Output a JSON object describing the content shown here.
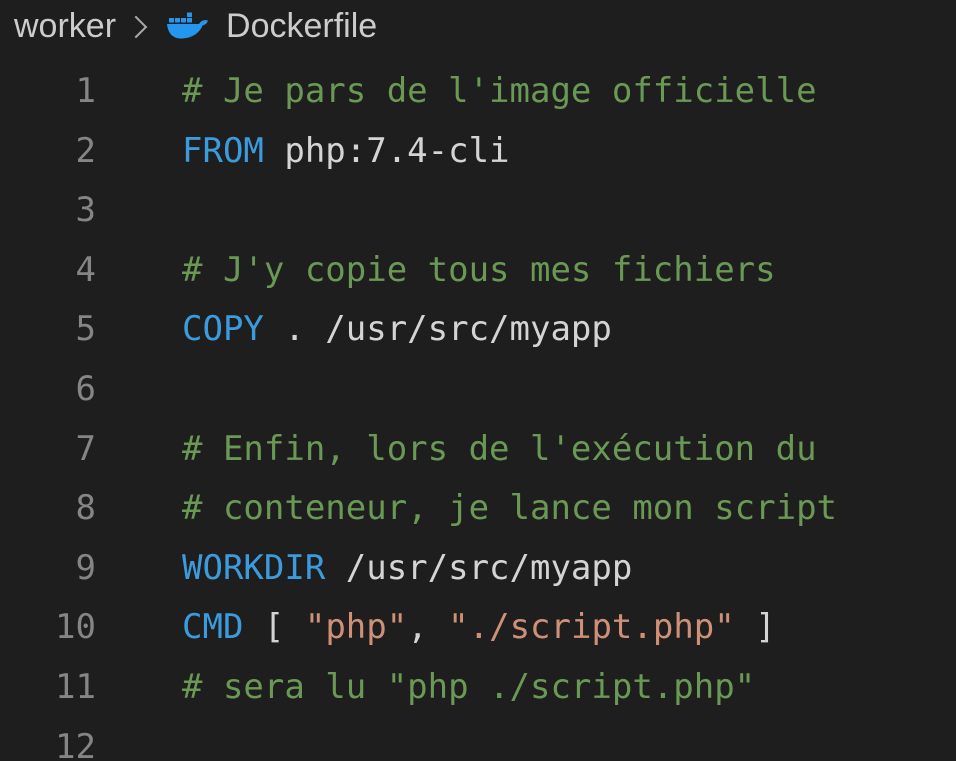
{
  "breadcrumb": {
    "folder": "worker",
    "file": "Dockerfile",
    "file_icon": "docker-whale-icon"
  },
  "colors": {
    "background": "#1e1e1e",
    "comment": "#6a9955",
    "keyword": "#3c9bdc",
    "string": "#ce9178",
    "text": "#d4d4d4",
    "line_number": "#858585",
    "docker_blue": "#2496ed"
  },
  "lines": [
    {
      "number": "1",
      "tokens": [
        {
          "type": "comment",
          "text": "# Je pars de l'image officielle"
        }
      ]
    },
    {
      "number": "2",
      "tokens": [
        {
          "type": "keyword",
          "text": "FROM"
        },
        {
          "type": "text",
          "text": " php:7.4-cli"
        }
      ]
    },
    {
      "number": "3",
      "tokens": []
    },
    {
      "number": "4",
      "tokens": [
        {
          "type": "comment",
          "text": "# J'y copie tous mes fichiers"
        }
      ]
    },
    {
      "number": "5",
      "tokens": [
        {
          "type": "keyword",
          "text": "COPY"
        },
        {
          "type": "text",
          "text": " . /usr/src/myapp"
        }
      ]
    },
    {
      "number": "6",
      "tokens": []
    },
    {
      "number": "7",
      "tokens": [
        {
          "type": "comment",
          "text": "# Enfin, lors de l'exécution du"
        }
      ]
    },
    {
      "number": "8",
      "tokens": [
        {
          "type": "comment",
          "text": "# conteneur, je lance mon script"
        }
      ]
    },
    {
      "number": "9",
      "tokens": [
        {
          "type": "keyword",
          "text": "WORKDIR"
        },
        {
          "type": "text",
          "text": " /usr/src/myapp"
        }
      ]
    },
    {
      "number": "10",
      "tokens": [
        {
          "type": "keyword",
          "text": "CMD"
        },
        {
          "type": "text",
          "text": " [ "
        },
        {
          "type": "string",
          "text": "\"php\""
        },
        {
          "type": "text",
          "text": ", "
        },
        {
          "type": "string",
          "text": "\"./script.php\""
        },
        {
          "type": "text",
          "text": " ]"
        }
      ]
    },
    {
      "number": "11",
      "tokens": [
        {
          "type": "comment",
          "text": "# sera lu \"php ./script.php\""
        }
      ]
    },
    {
      "number": "12",
      "tokens": []
    }
  ]
}
